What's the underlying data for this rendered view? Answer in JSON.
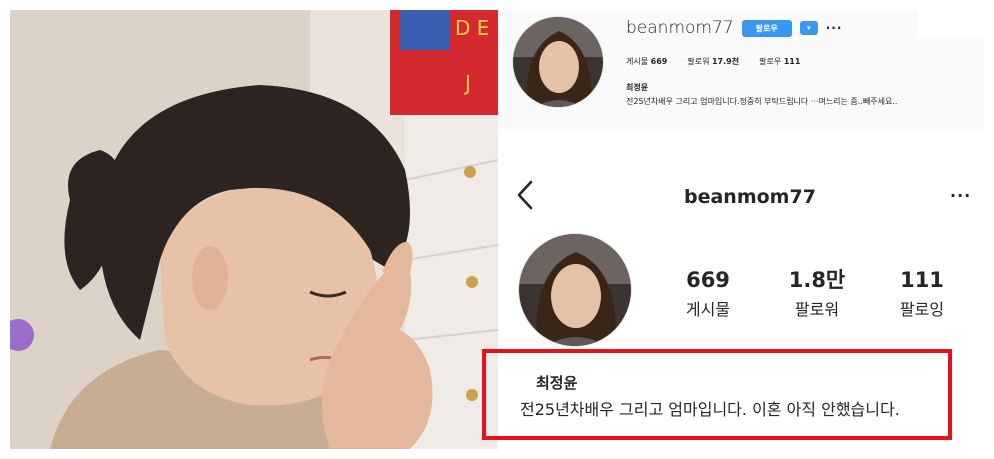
{
  "header_capture": {
    "username": "beanmom77",
    "follow_label": "팔로우",
    "dropdown_glyph": "▾",
    "more_glyph": "···",
    "stats": [
      {
        "label": "게시물",
        "value": "669"
      },
      {
        "label": "팔로워",
        "value": "17.9천"
      },
      {
        "label": "팔로우",
        "value": "111"
      }
    ],
    "name": "최정윤",
    "bio": "전25년차배우 그리고 엄마입니다.정중히 부탁드립니다 ···며느리는 좀..빼주세요.."
  },
  "mobile_profile": {
    "back_icon": "chevron-left-icon",
    "username": "beanmom77",
    "more_glyph": "···",
    "stats": [
      {
        "value": "669",
        "label": "게시물"
      },
      {
        "value": "1.8만",
        "label": "팔로워"
      },
      {
        "value": "111",
        "label": "팔로잉"
      }
    ],
    "name": "최정윤",
    "bio": "전25년차배우 그리고 엄마입니다. 이혼 아직 안했습니다."
  },
  "colors": {
    "follow_button": "#3897f0",
    "highlight_box": "#e8101a",
    "text": "#262626"
  }
}
